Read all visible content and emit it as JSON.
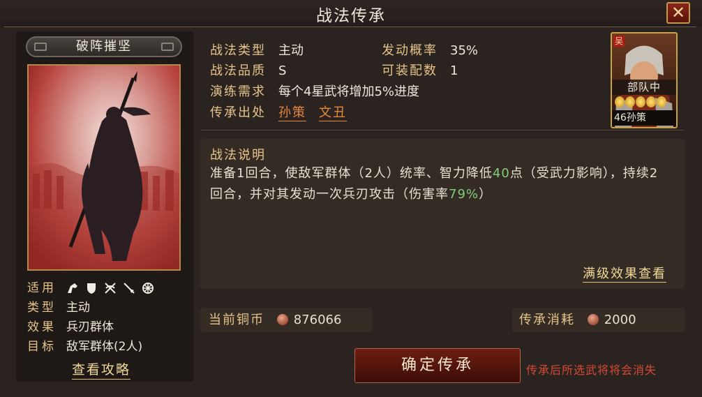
{
  "window": {
    "title": "战法传承",
    "close_label": "✕"
  },
  "skill": {
    "name": "破阵摧坚",
    "attributes": [
      {
        "label": "适用",
        "value": ""
      },
      {
        "label": "类型",
        "value": "主动"
      },
      {
        "label": "效果",
        "value": "兵刃群体"
      },
      {
        "label": "目标",
        "value": "敌军群体(2人)"
      }
    ],
    "unit_icons": [
      "cavalry-icon",
      "shield-icon",
      "bow-icon",
      "spear-icon",
      "siege-icon"
    ],
    "strategy_link": "查看攻略"
  },
  "info": {
    "type_label": "战法类型",
    "type_value": "主动",
    "rate_label": "发动概率",
    "rate_value": "35%",
    "quality_label": "战法品质",
    "quality_value": "S",
    "equip_label": "可装配数",
    "equip_value": "1",
    "train_label": "演练需求",
    "train_value": "每个4星武将增加5%进度",
    "source_label": "传承出处",
    "sources": [
      "孙策",
      "文丑"
    ]
  },
  "general": {
    "faction": "吴",
    "status": "部队中",
    "level_name": "46孙策",
    "stars": 5
  },
  "description": {
    "title": "战法说明",
    "p1": "准备1回合，使敌军群体（2人）统率、智力降低",
    "v1": "40",
    "p2": "点（受武力影响），持续2回合，并对其发动一次兵刃攻击（伤害率",
    "v2": "79%",
    "p3": "）",
    "full_link": "满级效果查看"
  },
  "currency": {
    "label": "当前铜币",
    "value": "876066"
  },
  "cost": {
    "label": "传承消耗",
    "value": "2000"
  },
  "confirm_label": "确定传承",
  "warning": "传承后所选武将将会消失"
}
